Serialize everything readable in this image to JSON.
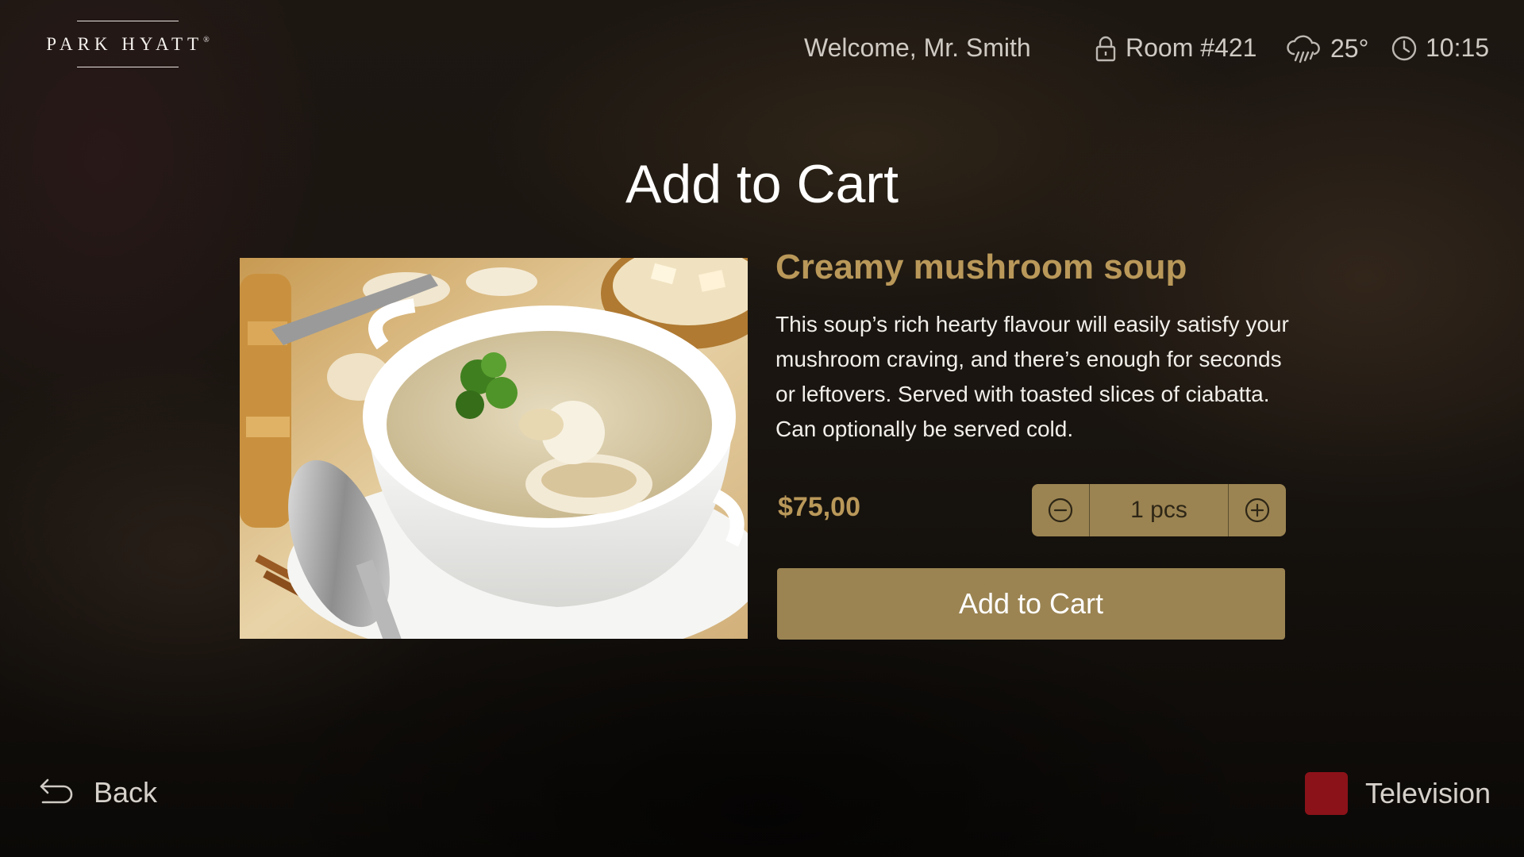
{
  "header": {
    "logo_text": "PARK HYATT",
    "logo_mark": "®",
    "welcome": "Welcome, Mr. Smith",
    "room": "Room #421",
    "temperature": "25°",
    "time": "10:15",
    "icons": {
      "room": "lock-icon",
      "weather": "rain-cloud-icon",
      "time": "clock-icon"
    }
  },
  "page": {
    "title": "Add to Cart"
  },
  "product": {
    "name": "Creamy mushroom soup",
    "description": "This soup’s rich hearty flavour will easily satisfy your mushroom craving, and there’s enough for seconds or leftovers. Served with toasted slices of ciabatta. Can optionally be served cold.",
    "price": "$75,00",
    "quantity": "1 pcs",
    "image": "mushroom-soup-photo"
  },
  "actions": {
    "add_to_cart": "Add to Cart",
    "decrement_icon": "minus-circle-icon",
    "increment_icon": "plus-circle-icon"
  },
  "footer": {
    "back_label": "Back",
    "back_icon": "back-arrow-icon",
    "tv_label": "Television",
    "tv_color": "#8b1219"
  },
  "colors": {
    "accent_gold": "#b99859",
    "button_gold": "#9b8452"
  }
}
